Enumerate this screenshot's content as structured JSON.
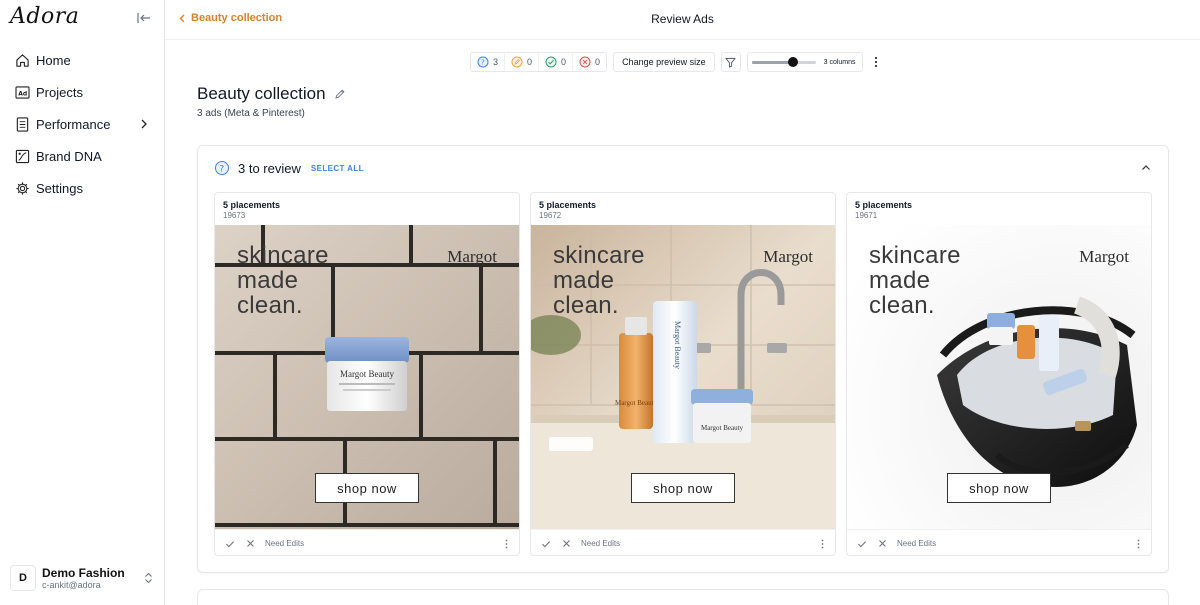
{
  "app": {
    "logo": "Adora"
  },
  "sidebar": {
    "items": [
      {
        "label": "Home",
        "icon": "home-icon"
      },
      {
        "label": "Projects",
        "icon": "ad-icon"
      },
      {
        "label": "Performance",
        "icon": "document-icon"
      },
      {
        "label": "Brand DNA",
        "icon": "brand-dna-icon"
      },
      {
        "label": "Settings",
        "icon": "gear-icon"
      }
    ],
    "workspace": {
      "initial": "D",
      "name": "Demo Fashion",
      "email": "c-ankit@adora"
    }
  },
  "header": {
    "back_label": "Beauty collection",
    "title": "Review Ads"
  },
  "toolbar": {
    "counts": {
      "to_review": "3",
      "need_edits": "0",
      "approved": "0",
      "rejected": "0"
    },
    "preview_size_label": "Change preview size",
    "slider_value": 0.65,
    "columns_label": "3 columns"
  },
  "page": {
    "title": "Beauty collection",
    "subtitle": "3 ads (Meta & Pinterest)"
  },
  "review": {
    "title": "3 to review",
    "select_all": "SELECT ALL",
    "ads": [
      {
        "placements": "5 placements",
        "id": "19673",
        "headline": [
          "skincare",
          "made",
          "clean."
        ],
        "brand": "Margot",
        "cta": "shop now",
        "need_edits": "Need Edits"
      },
      {
        "placements": "5 placements",
        "id": "19672",
        "headline": [
          "skincare",
          "made",
          "clean."
        ],
        "brand": "Margot",
        "cta": "shop now",
        "need_edits": "Need Edits"
      },
      {
        "placements": "5 placements",
        "id": "19671",
        "headline": [
          "skincare",
          "made",
          "clean."
        ],
        "brand": "Margot",
        "cta": "shop now",
        "need_edits": "Need Edits"
      }
    ]
  },
  "product_labels": {
    "jar": "Margot Beauty",
    "tube": "Margot Beauty",
    "bottle": "Margot Beauty",
    "jar2": "Margot Beauty"
  },
  "colors": {
    "accent": "#d9822b",
    "link": "#3b82f6"
  }
}
